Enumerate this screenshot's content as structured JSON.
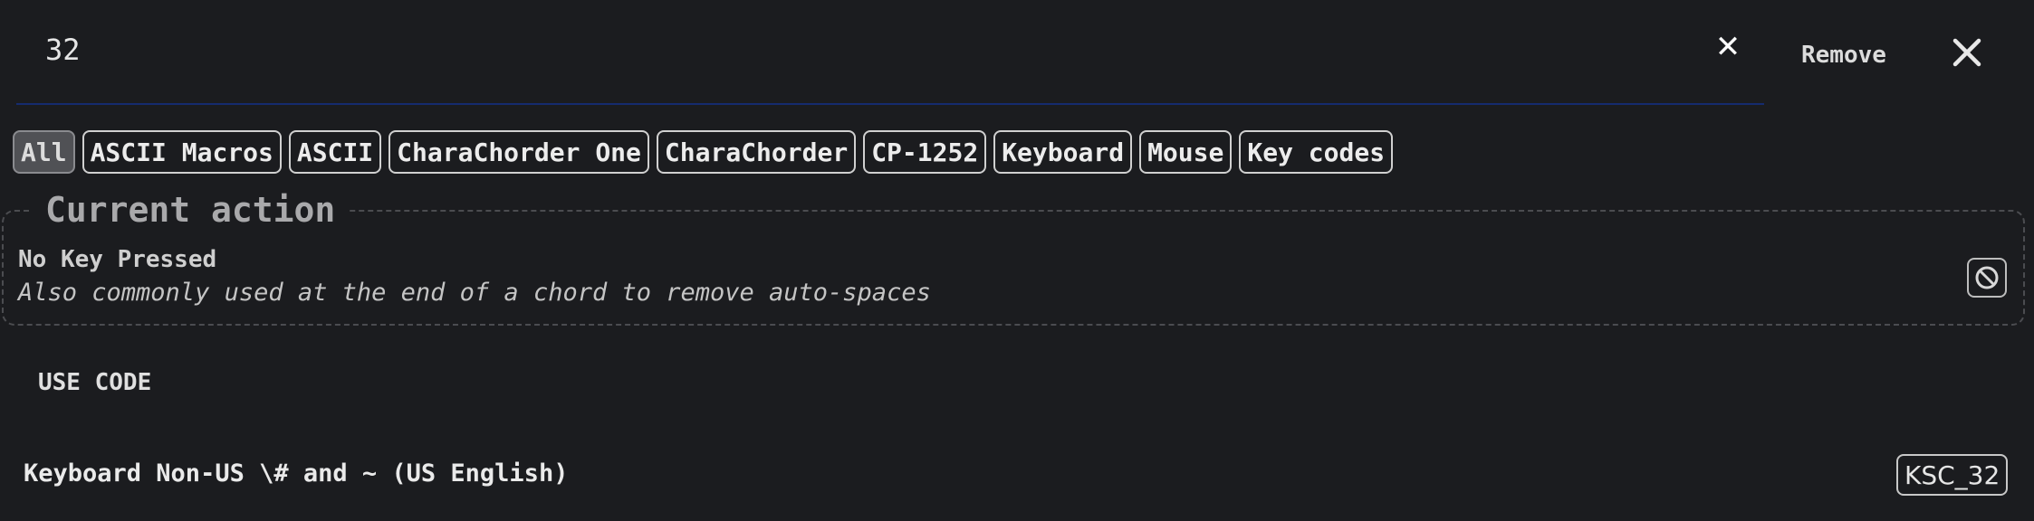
{
  "search": {
    "value": "32",
    "clear_glyph": "✕",
    "remove_label": "Remove",
    "close_glyph": "✕"
  },
  "filters": [
    {
      "label": "All",
      "active": true
    },
    {
      "label": "ASCII Macros",
      "active": false
    },
    {
      "label": "ASCII",
      "active": false
    },
    {
      "label": "CharaChorder One",
      "active": false
    },
    {
      "label": "CharaChorder",
      "active": false
    },
    {
      "label": "CP-1252",
      "active": false
    },
    {
      "label": "Keyboard",
      "active": false
    },
    {
      "label": "Mouse",
      "active": false
    },
    {
      "label": "Key codes",
      "active": false
    }
  ],
  "current_action": {
    "legend": "Current action",
    "title": "No Key Pressed",
    "description": "Also commonly used at the end of a chord to remove auto-spaces",
    "icon": "block-icon"
  },
  "use_code_label": "USE CODE",
  "results": [
    {
      "label": "Keyboard Non-US \\# and ~ (US English)",
      "code": "KSC_32"
    }
  ],
  "colors": {
    "background": "#1b1c1f",
    "search_underline": "#152b6e",
    "active_chip": "#505155"
  }
}
